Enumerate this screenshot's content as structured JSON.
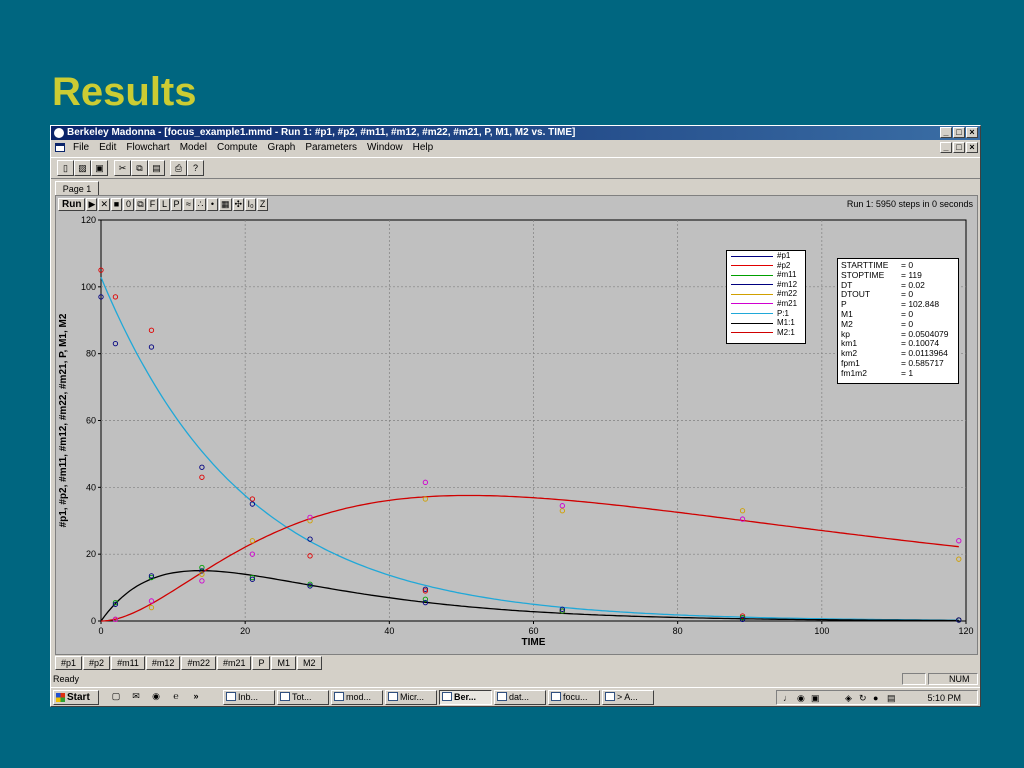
{
  "slide_title": "Results",
  "window": {
    "title": "Berkeley Madonna - [focus_example1.mmd - Run 1: #p1, #p2, #m11, #m12, #m22, #m21, P, M1, M2 vs. TIME]",
    "min": "_",
    "max": "□",
    "close": "×"
  },
  "menu": [
    "File",
    "Edit",
    "Flowchart",
    "Model",
    "Compute",
    "Graph",
    "Parameters",
    "Window",
    "Help"
  ],
  "toolbar_icons": [
    "new-icon",
    "open-icon",
    "save-icon",
    "cut-icon",
    "copy-icon",
    "paste-icon",
    "print-icon",
    "help-icon"
  ],
  "page_tab": "Page 1",
  "plot_toolbar": {
    "run": "Run",
    "buttons": [
      "▶",
      "✕",
      "■",
      "0",
      "⧉",
      "F",
      "L",
      "P",
      "≈",
      "∴",
      "•",
      "▦",
      "✣",
      "I₀",
      "Z"
    ]
  },
  "run_info": "Run 1: 5950 steps in 0 seconds",
  "legend": [
    {
      "label": "#p1",
      "color": "#000080"
    },
    {
      "label": "#p2",
      "color": "#e00000"
    },
    {
      "label": "#m11",
      "color": "#00a000"
    },
    {
      "label": "#m12",
      "color": "#000080"
    },
    {
      "label": "#m22",
      "color": "#d0a000"
    },
    {
      "label": "#m21",
      "color": "#d000d0"
    },
    {
      "label": "P:1",
      "color": "#20a8d8"
    },
    {
      "label": "M1:1",
      "color": "#000000"
    },
    {
      "label": "M2:1",
      "color": "#d00000"
    }
  ],
  "params": [
    {
      "k": "STARTTIME",
      "v": "= 0"
    },
    {
      "k": "STOPTIME",
      "v": "= 119"
    },
    {
      "k": "DT",
      "v": "= 0.02"
    },
    {
      "k": "DTOUT",
      "v": "= 0"
    },
    {
      "k": "P",
      "v": "= 102.848"
    },
    {
      "k": "M1",
      "v": "= 0"
    },
    {
      "k": "M2",
      "v": "= 0"
    },
    {
      "k": "kp",
      "v": "= 0.0504079"
    },
    {
      "k": "km1",
      "v": "= 0.10074"
    },
    {
      "k": "km2",
      "v": "= 0.0113964"
    },
    {
      "k": "fpm1",
      "v": "= 0.585717"
    },
    {
      "k": "fm1m2",
      "v": "= 1"
    }
  ],
  "bottom_tabs": [
    "#p1",
    "#p2",
    "#m11",
    "#m12",
    "#m22",
    "#m21",
    "P",
    "M1",
    "M2"
  ],
  "status": {
    "left": "Ready",
    "num": "NUM"
  },
  "taskbar": {
    "start": "Start",
    "more": "»",
    "tasks": [
      {
        "label": "Inb...",
        "active": false
      },
      {
        "label": "Tot...",
        "active": false
      },
      {
        "label": "mod...",
        "active": false
      },
      {
        "label": "Micr...",
        "active": false
      },
      {
        "label": "Ber...",
        "active": true
      },
      {
        "label": "dat...",
        "active": false
      },
      {
        "label": "focu...",
        "active": false
      },
      {
        "label": "> A...",
        "active": false
      }
    ],
    "clock": "5:10 PM"
  },
  "chart_data": {
    "type": "scatter",
    "xlabel": "TIME",
    "ylabel": "#p1, #p2, #m11, #m12, #m22, #m21, P, M1, M2",
    "xlim": [
      0,
      120
    ],
    "ylim": [
      0,
      120
    ],
    "xticks": [
      0,
      20,
      40,
      60,
      80,
      100,
      120
    ],
    "yticks": [
      0,
      20,
      40,
      60,
      80,
      100,
      120
    ],
    "grid": true,
    "legend_position": "top-right",
    "model": {
      "P0": 102.848,
      "kp": 0.0504079,
      "km1": 0.10074,
      "km2": 0.0113964,
      "fpm1": 0.585717,
      "fm1m2": 1,
      "tmax": 119
    },
    "lines": [
      {
        "name": "P:1",
        "color": "#20a8d8"
      },
      {
        "name": "M1:1",
        "color": "#000000"
      },
      {
        "name": "M2:1",
        "color": "#d00000"
      }
    ],
    "series": [
      {
        "name": "#p1",
        "color": "#000080",
        "x": [
          0,
          2,
          7,
          14,
          21,
          29,
          45,
          64,
          89,
          119
        ],
        "y": [
          97,
          83,
          82,
          46,
          35,
          24.5,
          9.5,
          3,
          1,
          0.3
        ]
      },
      {
        "name": "#p2",
        "color": "#e00000",
        "x": [
          0,
          2,
          7,
          14,
          21,
          29,
          45,
          64,
          89,
          119
        ],
        "y": [
          105,
          97,
          87,
          43,
          36.5,
          19.5,
          9,
          3,
          1.5,
          0.3
        ]
      },
      {
        "name": "#m11",
        "color": "#00a000",
        "x": [
          2,
          7,
          14,
          21,
          29,
          45,
          64,
          89,
          119
        ],
        "y": [
          5.5,
          13,
          16,
          13,
          11,
          6.5,
          3,
          1,
          0.3
        ]
      },
      {
        "name": "#m12",
        "color": "#000080",
        "x": [
          2,
          7,
          14,
          21,
          29,
          45,
          64,
          89,
          119
        ],
        "y": [
          5,
          13.5,
          15,
          12.5,
          10.5,
          5.5,
          3.5,
          0.5,
          0.3
        ]
      },
      {
        "name": "#m22",
        "color": "#d0a000",
        "x": [
          2,
          7,
          14,
          21,
          29,
          45,
          64,
          89,
          119
        ],
        "y": [
          0.5,
          4,
          14,
          24,
          30,
          36.5,
          33,
          33,
          18.5
        ]
      },
      {
        "name": "#m21",
        "color": "#d000d0",
        "x": [
          2,
          7,
          14,
          21,
          29,
          45,
          64,
          89,
          119
        ],
        "y": [
          0.5,
          6,
          12,
          20,
          31,
          41.5,
          34.5,
          30.5,
          24
        ]
      }
    ]
  }
}
